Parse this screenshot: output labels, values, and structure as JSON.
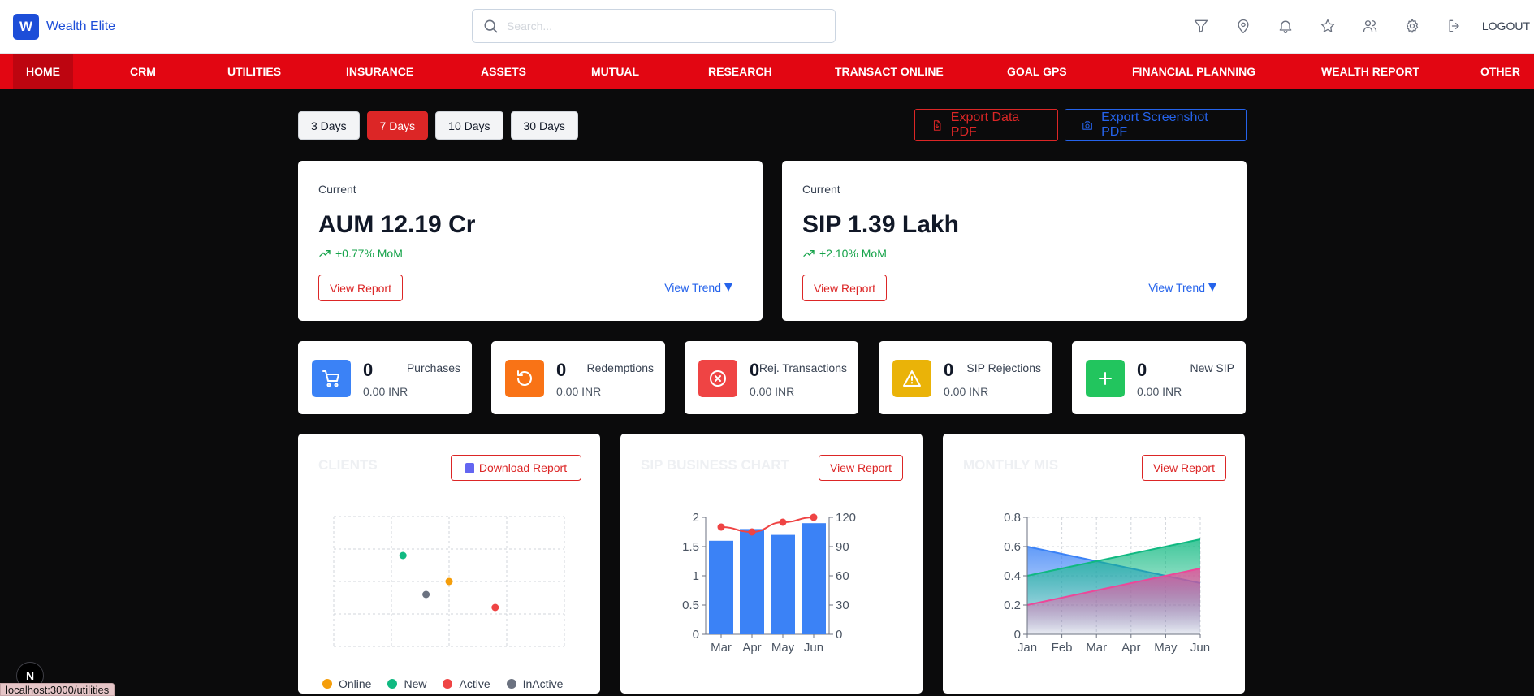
{
  "header": {
    "logo_letter": "W",
    "brand": "Wealth Elite",
    "search_placeholder": "Search...",
    "icons": [
      "filter-icon",
      "location-pin-icon",
      "bell-icon",
      "star-icon",
      "users-icon",
      "gear-icon",
      "logout-icon"
    ],
    "logout_label": "LOGOUT"
  },
  "nav": {
    "items": [
      "HOME",
      "CRM",
      "UTILITIES",
      "INSURANCE",
      "ASSETS",
      "MUTUAL",
      "RESEARCH",
      "TRANSACT ONLINE",
      "GOAL GPS",
      "FINANCIAL PLANNING",
      "WEALTH REPORT",
      "OTHER"
    ],
    "active": "HOME"
  },
  "filters": {
    "days": [
      "3 Days",
      "7 Days",
      "10 Days",
      "30 Days"
    ],
    "active": "7 Days"
  },
  "exports": {
    "data_pdf": "Export Data PDF",
    "screenshot_pdf": "Export Screenshot PDF"
  },
  "summary": [
    {
      "label": "Current",
      "value": "AUM 12.19 Cr",
      "change": "+0.77% MoM",
      "report": "View Report",
      "trend": "View Trend"
    },
    {
      "label": "Current",
      "value": "SIP 1.39 Lakh",
      "change": "+2.10% MoM",
      "report": "View Report",
      "trend": "View Trend"
    }
  ],
  "stats": [
    {
      "count": "0",
      "label": "Purchases",
      "amount": "0.00 INR",
      "color": "#3b82f6",
      "icon": "cart-icon"
    },
    {
      "count": "0",
      "label": "Redemptions",
      "amount": "0.00 INR",
      "color": "#f97316",
      "icon": "refresh-icon"
    },
    {
      "count": "0",
      "label": "Rej. Transactions",
      "amount": "0.00 INR",
      "color": "#ef4444",
      "icon": "x-circle-icon"
    },
    {
      "count": "0",
      "label": "SIP Rejections",
      "amount": "0.00 INR",
      "color": "#eab308",
      "icon": "warning-icon"
    },
    {
      "count": "0",
      "label": "New SIP",
      "amount": "0.00 INR",
      "color": "#22c55e",
      "icon": "plus-icon"
    }
  ],
  "cards": {
    "clients": {
      "title": "CLIENTS",
      "button": "Download Report"
    },
    "sip": {
      "title": "SIP BUSINESS CHART",
      "button": "View Report"
    },
    "mis": {
      "title": "MONTHLY MIS",
      "button": "View Report"
    }
  },
  "chart_data": [
    {
      "type": "scatter",
      "title": "CLIENTS",
      "series": [
        {
          "name": "Online",
          "color": "#f59e0b",
          "points": [
            [
              2.0,
              1.0
            ]
          ]
        },
        {
          "name": "New",
          "color": "#10b981",
          "points": [
            [
              1.2,
              1.8
            ]
          ]
        },
        {
          "name": "Active",
          "color": "#ef4444",
          "points": [
            [
              2.8,
              0.2
            ]
          ]
        },
        {
          "name": "InActive",
          "color": "#6b7280",
          "points": [
            [
              1.6,
              0.6
            ]
          ]
        }
      ],
      "xlim": [
        0,
        4
      ],
      "ylim": [
        -1,
        3
      ],
      "grid": true,
      "legend": "bottom"
    },
    {
      "type": "bar",
      "title": "SIP BUSINESS CHART",
      "categories": [
        "Mar",
        "Apr",
        "May",
        "Jun"
      ],
      "series": [
        {
          "type": "bar",
          "axis": "left",
          "color": "#3b82f6",
          "values": [
            1.6,
            1.8,
            1.7,
            1.9
          ]
        },
        {
          "type": "line",
          "axis": "right",
          "color": "#ef4444",
          "values": [
            110,
            105,
            115,
            120
          ]
        }
      ],
      "y_left": {
        "lim": [
          0,
          2
        ],
        "ticks": [
          "0",
          "0.5",
          "1",
          "1.5",
          "2"
        ]
      },
      "y_right": {
        "lim": [
          0,
          120
        ],
        "ticks": [
          "0",
          "30",
          "60",
          "90",
          "120"
        ]
      }
    },
    {
      "type": "area",
      "title": "MONTHLY MIS",
      "categories": [
        "Jan",
        "Feb",
        "Mar",
        "Apr",
        "May",
        "Jun"
      ],
      "series": [
        {
          "color": "#3b82f6",
          "values": [
            0.6,
            0.55,
            0.5,
            0.45,
            0.4,
            0.35
          ]
        },
        {
          "color": "#10b981",
          "values": [
            0.4,
            0.45,
            0.5,
            0.55,
            0.6,
            0.65
          ]
        },
        {
          "color": "#ec4899",
          "values": [
            0.2,
            0.25,
            0.3,
            0.35,
            0.4,
            0.45
          ]
        }
      ],
      "ylim": [
        0,
        0.8
      ],
      "y_ticks": [
        "0",
        "0.2",
        "0.4",
        "0.6",
        "0.8"
      ],
      "grid": true
    }
  ],
  "status_bar": "localhost:3000/utilities",
  "dev_badge": "N"
}
